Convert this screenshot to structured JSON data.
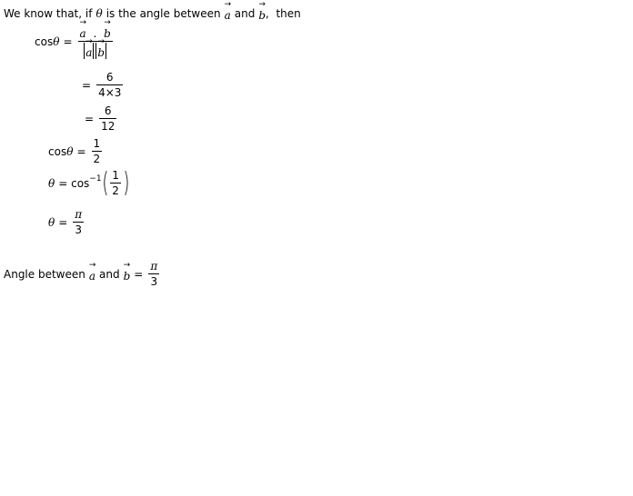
{
  "intro": {
    "part1": "We know that, if",
    "theta": "θ",
    "part2": "is the angle between",
    "a": "a",
    "and": "and",
    "b": "b",
    "part3": ",  then"
  },
  "step1": {
    "lhs": "cos",
    "theta": "θ",
    "eq": "=",
    "num_a": "a",
    "dot": ".",
    "num_b": "b",
    "den_a": "a",
    "den_b": "b"
  },
  "step2": {
    "eq": "=",
    "num": "6",
    "den": "4×3"
  },
  "step3": {
    "eq": "=",
    "num": "6",
    "den": "12"
  },
  "step4": {
    "lhs": "cos",
    "theta": "θ",
    "eq": "=",
    "num": "1",
    "den": "2"
  },
  "step5": {
    "theta": "θ",
    "eq": "= cos",
    "sup": "−1",
    "num": "1",
    "den": "2"
  },
  "step6": {
    "theta": "θ",
    "eq": "=",
    "num": "π",
    "den": "3"
  },
  "conclusion": {
    "label": "Angle between",
    "a": "a",
    "and": "and",
    "b": "b",
    "eq": "=",
    "num": "π",
    "den": "3"
  },
  "arrow_glyph": "→"
}
